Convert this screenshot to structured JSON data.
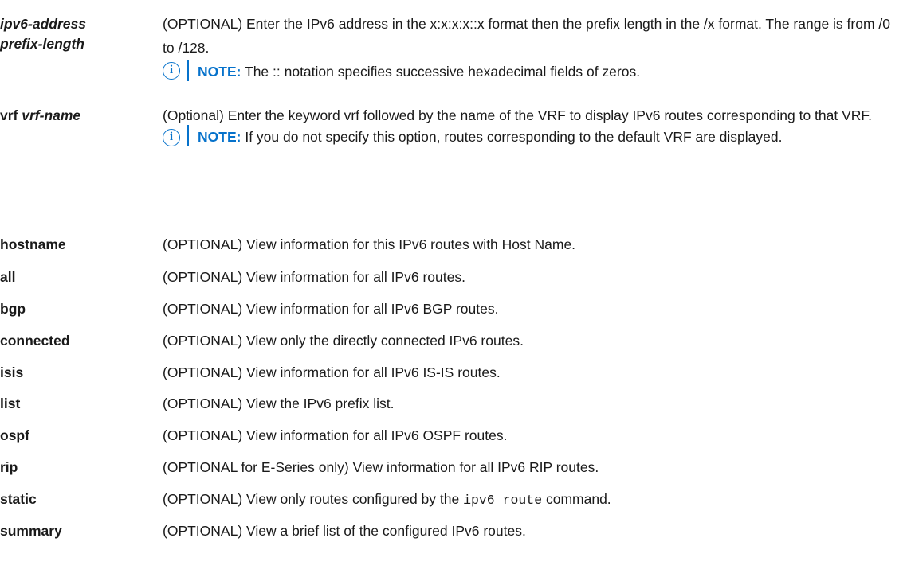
{
  "rows": [
    {
      "term_lines": [
        "ipv6-address",
        "prefix-length"
      ],
      "desc": "(OPTIONAL) Enter the IPv6 address in the x:x:x:x::x format then the prefix length in the /x format. The range is from /0 to /128.",
      "note_label": "NOTE:",
      "note_text": "The :: notation specifies successive hexadecimal fields of zeros."
    },
    {
      "term_kw": "vrf",
      "term_arg": "vrf-name",
      "desc": "(Optional) Enter the keyword vrf followed by the name of the VRF to display IPv6 routes corresponding to that VRF.",
      "note_label": "NOTE:",
      "note_text": "If you do not specify this option, routes corresponding to the default VRF are displayed."
    },
    {
      "term": "hostname",
      "desc": "(OPTIONAL) View information for this IPv6 routes with Host Name."
    },
    {
      "term": "all",
      "desc": "(OPTIONAL) View information for all IPv6 routes."
    },
    {
      "term": "bgp",
      "desc": "(OPTIONAL) View information for all IPv6 BGP routes."
    },
    {
      "term": "connected",
      "desc": "(OPTIONAL) View only the directly connected IPv6 routes."
    },
    {
      "term": "isis",
      "desc": "(OPTIONAL) View information for all IPv6 IS-IS routes."
    },
    {
      "term": "list",
      "desc": "(OPTIONAL) View the IPv6 prefix list."
    },
    {
      "term": "ospf",
      "desc": "(OPTIONAL) View information for all IPv6 OSPF routes."
    },
    {
      "term": "rip",
      "desc": "(OPTIONAL for E-Series only) View information for all IPv6 RIP routes."
    },
    {
      "term": "static",
      "desc_before": "(OPTIONAL) View only routes configured by the ",
      "desc_code": "ipv6 route",
      "desc_after": " command."
    },
    {
      "term": "summary",
      "desc": "(OPTIONAL) View a brief list of the configured IPv6 routes."
    }
  ]
}
